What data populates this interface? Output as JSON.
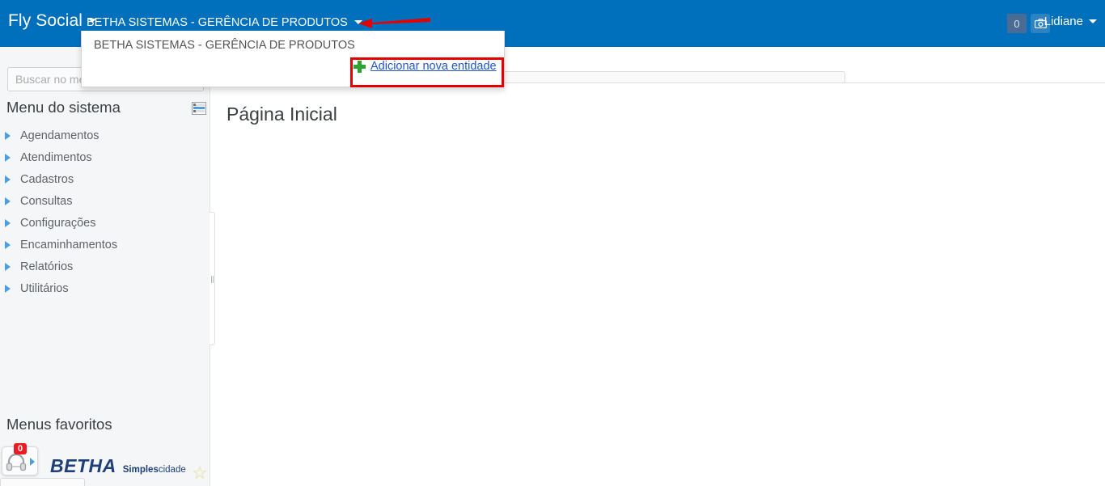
{
  "topbar": {
    "brand": "Fly Social",
    "entity_selector": "BETHA SISTEMAS - GERÊNCIA DE PRODUTOS",
    "notification_count": "0",
    "camera_icon": "camera-icon",
    "user_name": "Lidiane",
    "background_color": "#0070bd"
  },
  "entity_dropdown": {
    "visible": true,
    "options": [
      "BETHA SISTEMAS - GERÊNCIA DE PRODUTOS"
    ],
    "add_entity_label": "Adicionar nova entidade",
    "plus_icon": "plus-icon",
    "plus_color": "#2fa32f",
    "link_color": "#2255cc"
  },
  "annotations": {
    "highlight_box_color": "#e30000",
    "arrow_color": "#e30000",
    "arrow_direction": "left",
    "highlight_target": "Adicionar nova entidade"
  },
  "sidebar": {
    "search_placeholder": "Buscar no menu (Alt + B)",
    "search_value": "",
    "system_menu_title": "Menu do sistema",
    "list_icon": "list-view-icon",
    "items": [
      {
        "label": "Agendamentos",
        "icon": "triangle-right-icon"
      },
      {
        "label": "Atendimentos",
        "icon": "triangle-right-icon"
      },
      {
        "label": "Cadastros",
        "icon": "triangle-right-icon"
      },
      {
        "label": "Consultas",
        "icon": "triangle-right-icon"
      },
      {
        "label": "Configurações",
        "icon": "triangle-right-icon"
      },
      {
        "label": "Encaminhamentos",
        "icon": "triangle-right-icon"
      },
      {
        "label": "Relatórios",
        "icon": "triangle-right-icon"
      },
      {
        "label": "Utilitários",
        "icon": "triangle-right-icon"
      }
    ],
    "favorites_title": "Menus favoritos",
    "star_icon": "star-icon",
    "star_color": "#ece9b6"
  },
  "support": {
    "icon": "headset-icon",
    "badge_count": "0",
    "badge_color": "#ed1c24",
    "tooltip_text": ""
  },
  "footer_logo": {
    "main": "BETHA",
    "tagline_bold": "Simples",
    "tagline_light": "cidade",
    "color": "#1f3f7a"
  },
  "main": {
    "page_title": "Página Inicial"
  }
}
